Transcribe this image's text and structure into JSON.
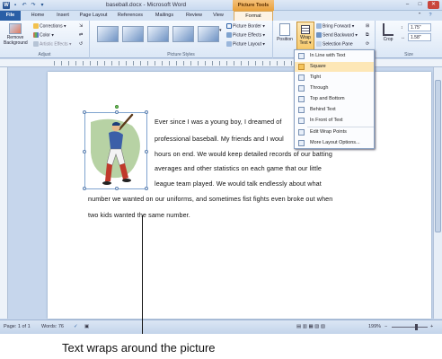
{
  "titlebar": {
    "doc_title": "baseball.docx - Microsoft Word",
    "context_group": "Picture Tools"
  },
  "tabs": [
    "File",
    "Home",
    "Insert",
    "Page Layout",
    "References",
    "Mailings",
    "Review",
    "View",
    "Format"
  ],
  "ribbon": {
    "adjust": {
      "remove_bg_1": "Remove",
      "remove_bg_2": "Background",
      "corrections": "Corrections ▾",
      "color": "Color ▾",
      "artistic": "Artistic Effects ▾",
      "label": "Adjust"
    },
    "picture_styles": {
      "border": "Picture Border ▾",
      "effects": "Picture Effects ▾",
      "layout": "Picture Layout ▾",
      "label": "Picture Styles"
    },
    "arrange": {
      "position": "Position",
      "wrap_1": "Wrap",
      "wrap_2": "Text ▾",
      "bring_forward": "Bring Forward ▾",
      "send_backward": "Send Backward ▾",
      "selection_pane": "Selection Pane"
    },
    "size": {
      "crop": "Crop",
      "height": "1.75\"",
      "width": "1.58\"",
      "label": "Size"
    }
  },
  "wrap_menu": {
    "items": [
      "In Line with Text",
      "Square",
      "Tight",
      "Through",
      "Top and Bottom",
      "Behind Text",
      "In Front of Text",
      "Edit Wrap Points",
      "More Layout Options..."
    ],
    "checked_index": 1
  },
  "document": {
    "lines": [
      "Ever since I was a young boy, I dreamed of",
      "professional baseball. My friends and I woul",
      "hours on end. We would keep detailed records of our batting",
      "averages and other statistics on each game that our little",
      "league team played. We would talk endlessly about what",
      "number we wanted on our uniforms, and sometimes fist fights even broke out when",
      "two kids wanted the same number."
    ]
  },
  "statusbar": {
    "page": "Page: 1 of 1",
    "words": "Words: 76",
    "zoom": "199%"
  },
  "caption": "Text wraps around the picture",
  "colors": {
    "accent": "#2a5fa6",
    "context_tab": "#e9a13d"
  }
}
